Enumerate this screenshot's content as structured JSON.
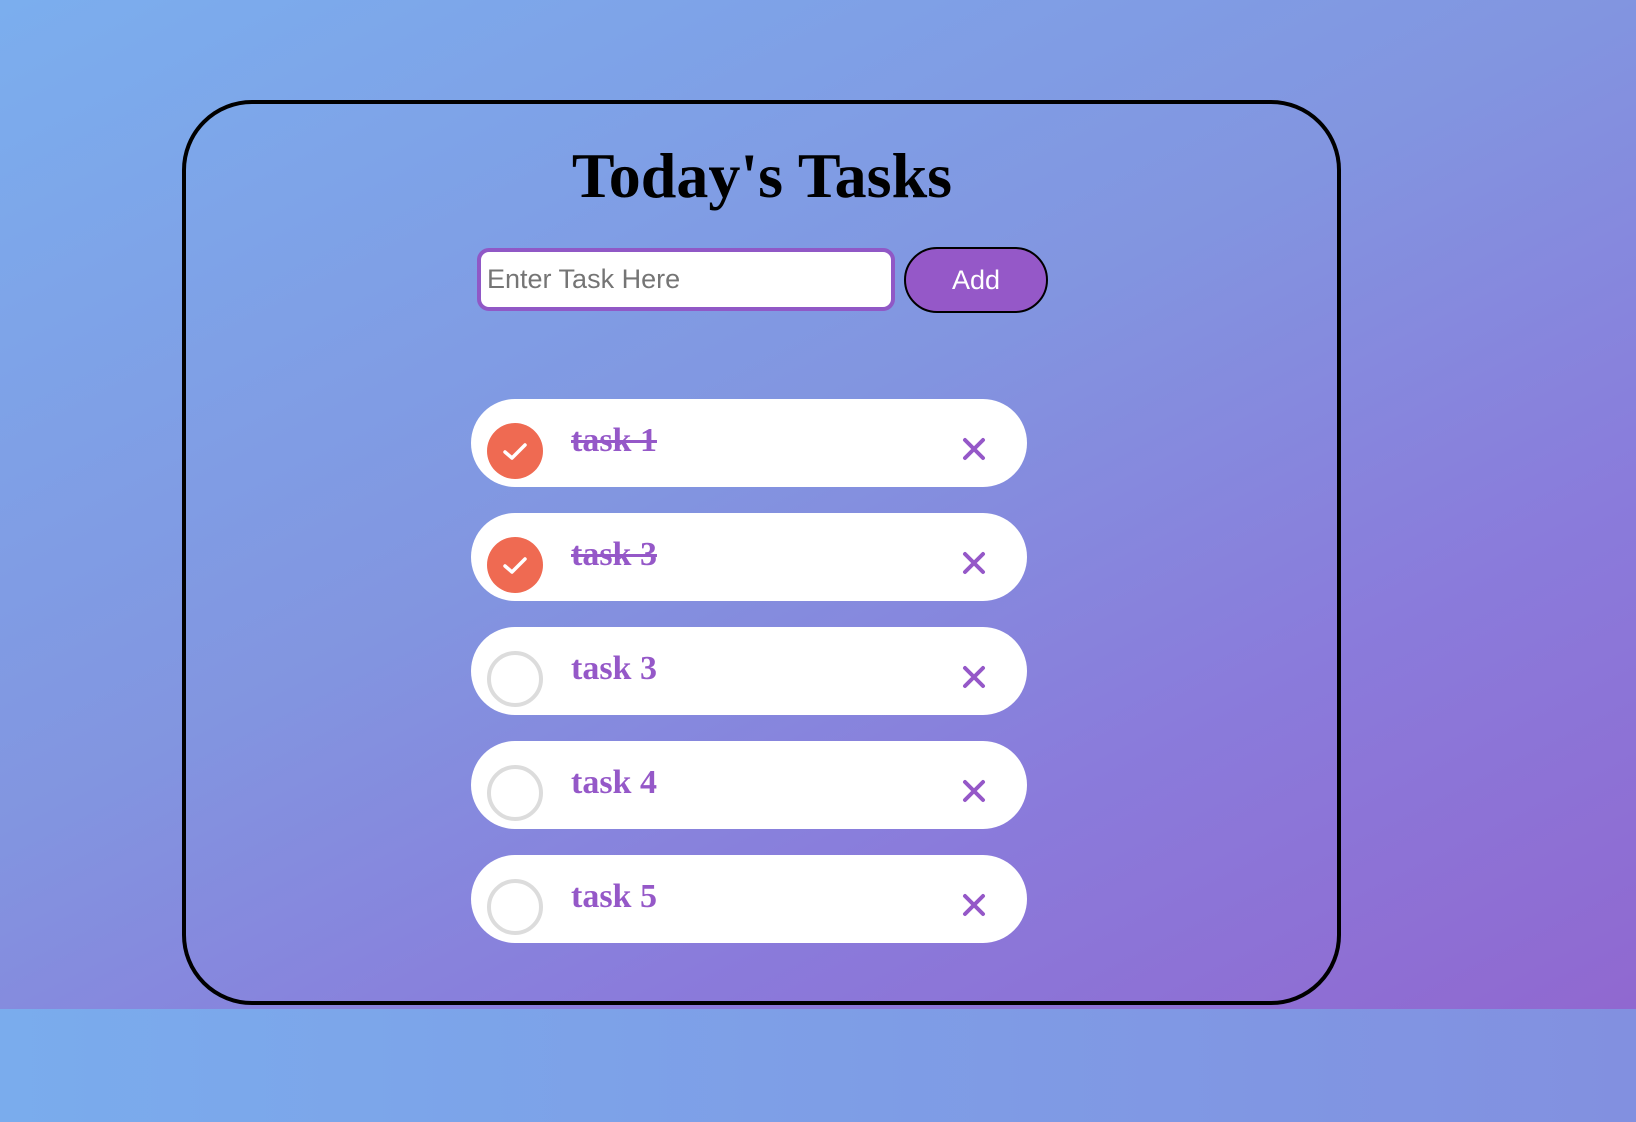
{
  "page": {
    "title": "Today's Tasks"
  },
  "input": {
    "placeholder": "Enter Task Here",
    "value": ""
  },
  "add_button": {
    "label": "Add"
  },
  "tasks": [
    {
      "label": "task 1",
      "completed": true
    },
    {
      "label": "task 3",
      "completed": true
    },
    {
      "label": "task 3",
      "completed": false
    },
    {
      "label": "task 4",
      "completed": false
    },
    {
      "label": "task 5",
      "completed": false
    }
  ],
  "icons": {
    "check": "check-icon",
    "delete": "close-icon"
  },
  "colors": {
    "accent": "#9558c8",
    "checked": "#ef6a52",
    "unchecked_ring": "#dcdcdc"
  }
}
